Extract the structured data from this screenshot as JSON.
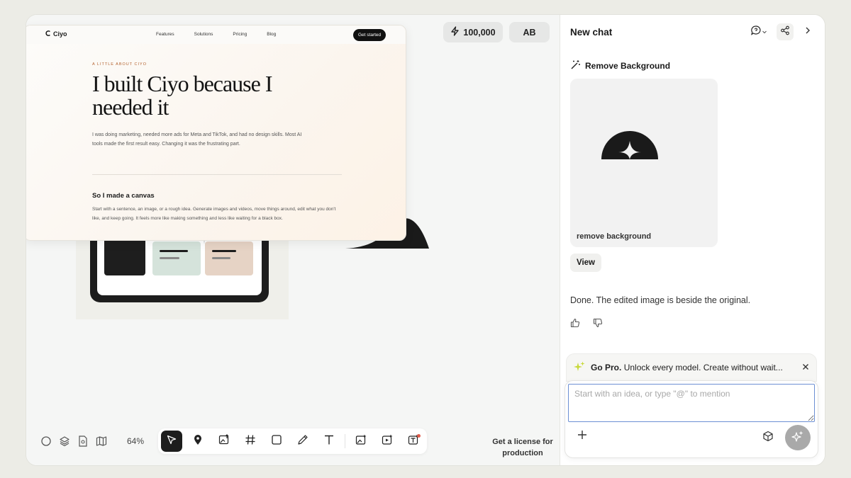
{
  "preview": {
    "logo": "Ciyo",
    "nav_links": [
      "Features",
      "Solutions",
      "Pricing",
      "Blog"
    ],
    "cta": "Get started",
    "eyebrow": "A LITTLE ABOUT CIYO",
    "headline": "I built Ciyo because I needed it",
    "intro": "I was doing marketing, needed more ads for Meta and TikTok, and had no design skills. Most AI tools made the first result easy. Changing it was the frustrating part.",
    "section_title": "So I made a canvas",
    "section_body": "Start with a sentence, an image, or a rough idea. Generate images and videos, move things around, edit what you don't like, and keep going. It feels more like making something and less like waiting for a black box."
  },
  "topbar": {
    "credits": "100,000",
    "avatar": "AB"
  },
  "toolbar": {
    "zoom": "64%",
    "license_line1": "Get a license for",
    "license_line2": "production"
  },
  "chat": {
    "title": "New chat",
    "tool_title": "Remove Background",
    "image_label": "remove background",
    "view_label": "View",
    "message": "Done. The edited image is beside the original.",
    "promo_bold": "Go Pro.",
    "promo_text": "Unlock every model. Create without wait...",
    "input_placeholder": "Start with an idea, or type \"@\" to mention"
  },
  "colors": {
    "accent_input": "#6c8fd3",
    "toolbar_active": "#1d1d1d",
    "eyebrow": "#b4622f"
  }
}
